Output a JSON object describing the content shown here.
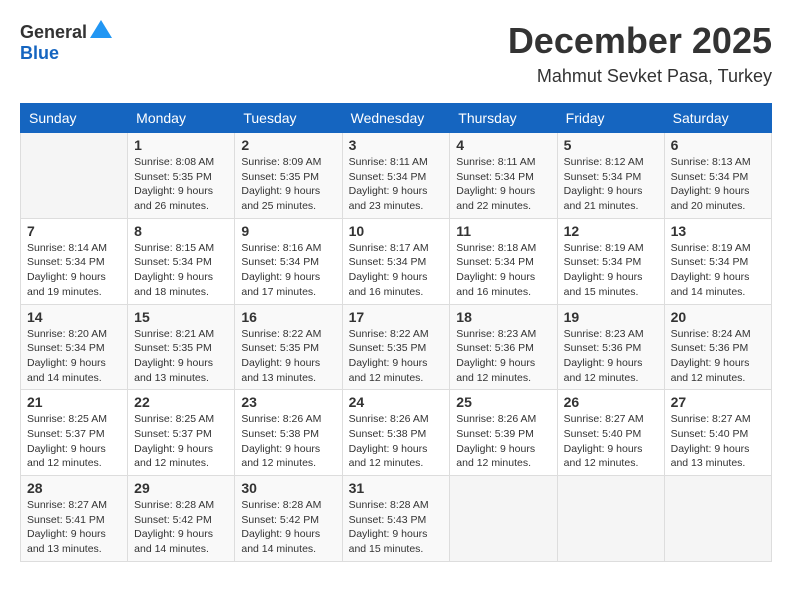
{
  "header": {
    "logo_general": "General",
    "logo_blue": "Blue",
    "month_title": "December 2025",
    "location": "Mahmut Sevket Pasa, Turkey"
  },
  "weekdays": [
    "Sunday",
    "Monday",
    "Tuesday",
    "Wednesday",
    "Thursday",
    "Friday",
    "Saturday"
  ],
  "weeks": [
    [
      {
        "day": "",
        "sunrise": "",
        "sunset": "",
        "daylight": ""
      },
      {
        "day": "1",
        "sunrise": "Sunrise: 8:08 AM",
        "sunset": "Sunset: 5:35 PM",
        "daylight": "Daylight: 9 hours and 26 minutes."
      },
      {
        "day": "2",
        "sunrise": "Sunrise: 8:09 AM",
        "sunset": "Sunset: 5:35 PM",
        "daylight": "Daylight: 9 hours and 25 minutes."
      },
      {
        "day": "3",
        "sunrise": "Sunrise: 8:11 AM",
        "sunset": "Sunset: 5:34 PM",
        "daylight": "Daylight: 9 hours and 23 minutes."
      },
      {
        "day": "4",
        "sunrise": "Sunrise: 8:11 AM",
        "sunset": "Sunset: 5:34 PM",
        "daylight": "Daylight: 9 hours and 22 minutes."
      },
      {
        "day": "5",
        "sunrise": "Sunrise: 8:12 AM",
        "sunset": "Sunset: 5:34 PM",
        "daylight": "Daylight: 9 hours and 21 minutes."
      },
      {
        "day": "6",
        "sunrise": "Sunrise: 8:13 AM",
        "sunset": "Sunset: 5:34 PM",
        "daylight": "Daylight: 9 hours and 20 minutes."
      }
    ],
    [
      {
        "day": "7",
        "sunrise": "Sunrise: 8:14 AM",
        "sunset": "Sunset: 5:34 PM",
        "daylight": "Daylight: 9 hours and 19 minutes."
      },
      {
        "day": "8",
        "sunrise": "Sunrise: 8:15 AM",
        "sunset": "Sunset: 5:34 PM",
        "daylight": "Daylight: 9 hours and 18 minutes."
      },
      {
        "day": "9",
        "sunrise": "Sunrise: 8:16 AM",
        "sunset": "Sunset: 5:34 PM",
        "daylight": "Daylight: 9 hours and 17 minutes."
      },
      {
        "day": "10",
        "sunrise": "Sunrise: 8:17 AM",
        "sunset": "Sunset: 5:34 PM",
        "daylight": "Daylight: 9 hours and 16 minutes."
      },
      {
        "day": "11",
        "sunrise": "Sunrise: 8:18 AM",
        "sunset": "Sunset: 5:34 PM",
        "daylight": "Daylight: 9 hours and 16 minutes."
      },
      {
        "day": "12",
        "sunrise": "Sunrise: 8:19 AM",
        "sunset": "Sunset: 5:34 PM",
        "daylight": "Daylight: 9 hours and 15 minutes."
      },
      {
        "day": "13",
        "sunrise": "Sunrise: 8:19 AM",
        "sunset": "Sunset: 5:34 PM",
        "daylight": "Daylight: 9 hours and 14 minutes."
      }
    ],
    [
      {
        "day": "14",
        "sunrise": "Sunrise: 8:20 AM",
        "sunset": "Sunset: 5:34 PM",
        "daylight": "Daylight: 9 hours and 14 minutes."
      },
      {
        "day": "15",
        "sunrise": "Sunrise: 8:21 AM",
        "sunset": "Sunset: 5:35 PM",
        "daylight": "Daylight: 9 hours and 13 minutes."
      },
      {
        "day": "16",
        "sunrise": "Sunrise: 8:22 AM",
        "sunset": "Sunset: 5:35 PM",
        "daylight": "Daylight: 9 hours and 13 minutes."
      },
      {
        "day": "17",
        "sunrise": "Sunrise: 8:22 AM",
        "sunset": "Sunset: 5:35 PM",
        "daylight": "Daylight: 9 hours and 12 minutes."
      },
      {
        "day": "18",
        "sunrise": "Sunrise: 8:23 AM",
        "sunset": "Sunset: 5:36 PM",
        "daylight": "Daylight: 9 hours and 12 minutes."
      },
      {
        "day": "19",
        "sunrise": "Sunrise: 8:23 AM",
        "sunset": "Sunset: 5:36 PM",
        "daylight": "Daylight: 9 hours and 12 minutes."
      },
      {
        "day": "20",
        "sunrise": "Sunrise: 8:24 AM",
        "sunset": "Sunset: 5:36 PM",
        "daylight": "Daylight: 9 hours and 12 minutes."
      }
    ],
    [
      {
        "day": "21",
        "sunrise": "Sunrise: 8:25 AM",
        "sunset": "Sunset: 5:37 PM",
        "daylight": "Daylight: 9 hours and 12 minutes."
      },
      {
        "day": "22",
        "sunrise": "Sunrise: 8:25 AM",
        "sunset": "Sunset: 5:37 PM",
        "daylight": "Daylight: 9 hours and 12 minutes."
      },
      {
        "day": "23",
        "sunrise": "Sunrise: 8:26 AM",
        "sunset": "Sunset: 5:38 PM",
        "daylight": "Daylight: 9 hours and 12 minutes."
      },
      {
        "day": "24",
        "sunrise": "Sunrise: 8:26 AM",
        "sunset": "Sunset: 5:38 PM",
        "daylight": "Daylight: 9 hours and 12 minutes."
      },
      {
        "day": "25",
        "sunrise": "Sunrise: 8:26 AM",
        "sunset": "Sunset: 5:39 PM",
        "daylight": "Daylight: 9 hours and 12 minutes."
      },
      {
        "day": "26",
        "sunrise": "Sunrise: 8:27 AM",
        "sunset": "Sunset: 5:40 PM",
        "daylight": "Daylight: 9 hours and 12 minutes."
      },
      {
        "day": "27",
        "sunrise": "Sunrise: 8:27 AM",
        "sunset": "Sunset: 5:40 PM",
        "daylight": "Daylight: 9 hours and 13 minutes."
      }
    ],
    [
      {
        "day": "28",
        "sunrise": "Sunrise: 8:27 AM",
        "sunset": "Sunset: 5:41 PM",
        "daylight": "Daylight: 9 hours and 13 minutes."
      },
      {
        "day": "29",
        "sunrise": "Sunrise: 8:28 AM",
        "sunset": "Sunset: 5:42 PM",
        "daylight": "Daylight: 9 hours and 14 minutes."
      },
      {
        "day": "30",
        "sunrise": "Sunrise: 8:28 AM",
        "sunset": "Sunset: 5:42 PM",
        "daylight": "Daylight: 9 hours and 14 minutes."
      },
      {
        "day": "31",
        "sunrise": "Sunrise: 8:28 AM",
        "sunset": "Sunset: 5:43 PM",
        "daylight": "Daylight: 9 hours and 15 minutes."
      },
      {
        "day": "",
        "sunrise": "",
        "sunset": "",
        "daylight": ""
      },
      {
        "day": "",
        "sunrise": "",
        "sunset": "",
        "daylight": ""
      },
      {
        "day": "",
        "sunrise": "",
        "sunset": "",
        "daylight": ""
      }
    ]
  ]
}
